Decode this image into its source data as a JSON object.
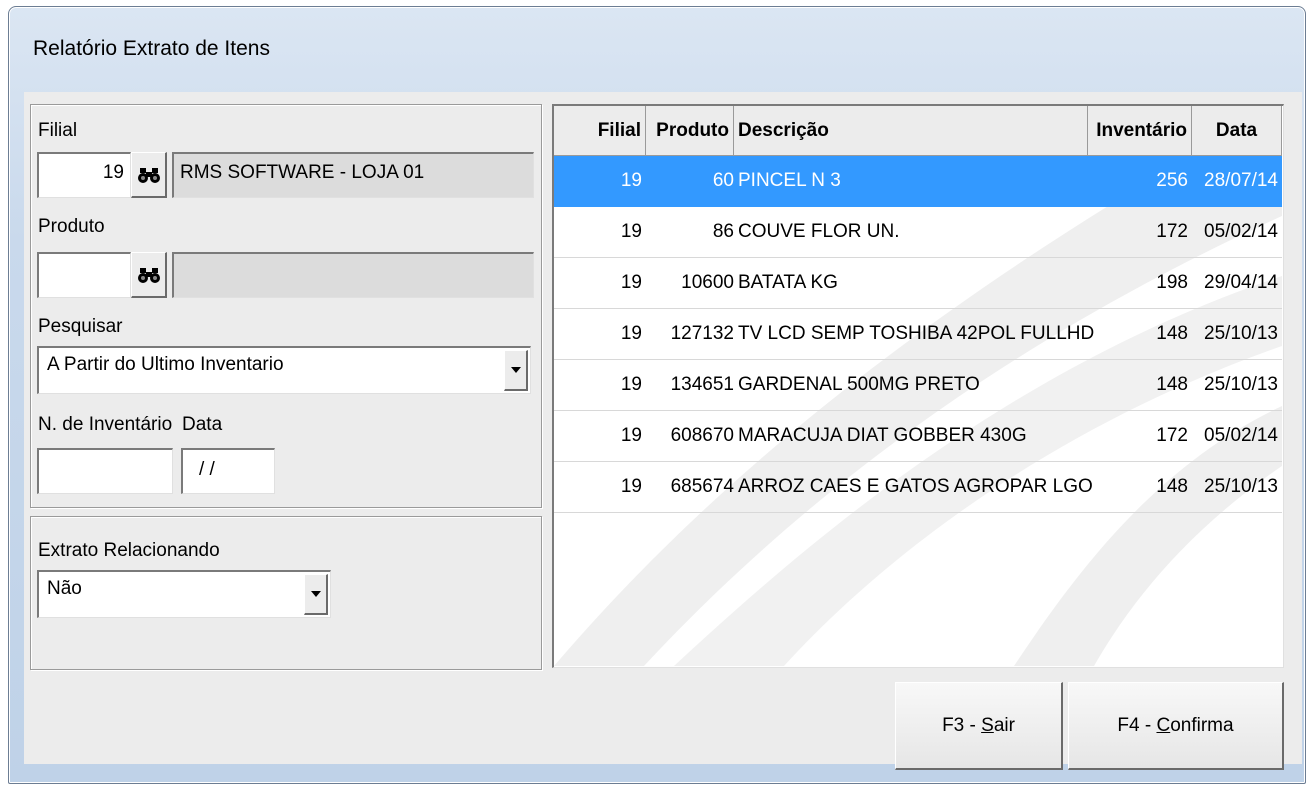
{
  "window": {
    "title": "Relatório Extrato de Itens"
  },
  "filter": {
    "filial_label": "Filial",
    "filial_value": "19",
    "filial_name": "RMS SOFTWARE - LOJA 01",
    "produto_label": "Produto",
    "produto_value": "",
    "produto_name": "",
    "pesquisar_label": "Pesquisar",
    "pesquisar_value": "A Partir do Ultimo Inventario",
    "inventario_label": "N. de Inventário",
    "inventario_value": "",
    "data_label": "Data",
    "data_value": " / /"
  },
  "extrato": {
    "label": "Extrato Relacionando",
    "value": "Não"
  },
  "grid": {
    "headers": {
      "filial": "Filial",
      "produto": "Produto",
      "descricao": "Descrição",
      "inventario": "Inventário",
      "data": "Data"
    },
    "rows": [
      {
        "filial": "19",
        "produto": "60",
        "descricao": "PINCEL N 3",
        "inventario": "256",
        "data": "28/07/14",
        "selected": true
      },
      {
        "filial": "19",
        "produto": "86",
        "descricao": "COUVE FLOR UN.",
        "inventario": "172",
        "data": "05/02/14"
      },
      {
        "filial": "19",
        "produto": "10600",
        "descricao": "BATATA KG",
        "inventario": "198",
        "data": "29/04/14"
      },
      {
        "filial": "19",
        "produto": "127132",
        "descricao": "TV LCD SEMP TOSHIBA 42POL FULLHD",
        "inventario": "148",
        "data": "25/10/13"
      },
      {
        "filial": "19",
        "produto": "134651",
        "descricao": "GARDENAL 500MG PRETO",
        "inventario": "148",
        "data": "25/10/13"
      },
      {
        "filial": "19",
        "produto": "608670",
        "descricao": "MARACUJA DIAT GOBBER 430G",
        "inventario": "172",
        "data": "05/02/14"
      },
      {
        "filial": "19",
        "produto": "685674",
        "descricao": "ARROZ CAES E GATOS AGROPAR LGO",
        "inventario": "148",
        "data": "25/10/13"
      }
    ]
  },
  "buttons": {
    "sair_prefix": "F3 - ",
    "sair_hotkey": "S",
    "sair_rest": "air",
    "confirma_prefix": "F4 - ",
    "confirma_hotkey": "C",
    "confirma_rest": "onfirma"
  },
  "icons": {
    "search": "binoculars-icon",
    "dropdown": "chevron-down-icon"
  },
  "colors": {
    "selection": "#3399ff"
  }
}
